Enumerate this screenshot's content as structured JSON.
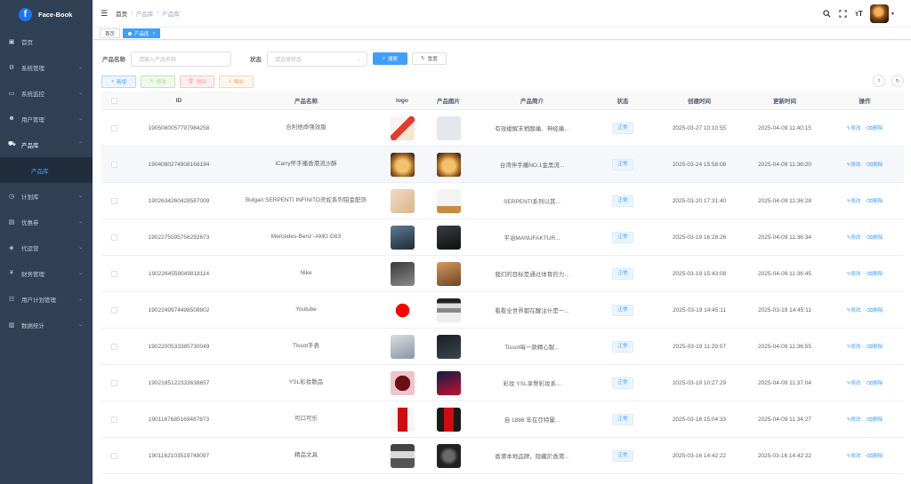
{
  "brand": {
    "logo_letter": "f",
    "name": "Face-Book",
    "color": "#1877f2"
  },
  "sidebar": {
    "items": [
      {
        "icon": "dashboard-icon",
        "glyph": "▣",
        "label": "首页",
        "arrow": ""
      },
      {
        "icon": "gear-icon",
        "glyph": "⚙",
        "label": "系统管理",
        "arrow": "⌄"
      },
      {
        "icon": "monitor-icon",
        "glyph": "▭",
        "label": "系统监控",
        "arrow": "⌄"
      },
      {
        "icon": "user-icon",
        "glyph": "☻",
        "label": "用户管理",
        "arrow": "⌄"
      },
      {
        "icon": "cart-icon",
        "glyph": "⛟",
        "label": "产品库",
        "arrow": "⌃"
      },
      {
        "icon": "calendar-icon",
        "glyph": "◷",
        "label": "计划库",
        "arrow": "⌄"
      },
      {
        "icon": "coupon-icon",
        "glyph": "▤",
        "label": "优惠券",
        "arrow": "⌄"
      },
      {
        "icon": "tag-icon",
        "glyph": "◈",
        "label": "代运营",
        "arrow": "⌄"
      },
      {
        "icon": "yen-icon",
        "glyph": "¥",
        "label": "财务管理",
        "arrow": "⌄"
      },
      {
        "icon": "user-plan-icon",
        "glyph": "☷",
        "label": "用户计划管理",
        "arrow": "⌄"
      },
      {
        "icon": "stats-icon",
        "glyph": "▥",
        "label": "数据统计",
        "arrow": "⌄"
      }
    ],
    "submenu_label": "产品库"
  },
  "header": {
    "breadcrumb": [
      "首页",
      "产品库",
      "产品库"
    ]
  },
  "tags": {
    "home": "首页",
    "active": "产品库"
  },
  "search": {
    "name_label": "产品名称",
    "name_placeholder": "请输入产品名称",
    "status_label": "状态",
    "status_placeholder": "请选择状态",
    "search_btn": "搜索",
    "reset_btn": "重置"
  },
  "toolbar": {
    "add": "新增",
    "edit": "修改",
    "delete": "删除",
    "export": "导出"
  },
  "table": {
    "columns": [
      "ID",
      "产品名称",
      "logo",
      "产品图片",
      "产品简介",
      "状态",
      "创建时间",
      "更新时间",
      "操作"
    ],
    "edit_label": "修改",
    "delete_label": "删除",
    "rows": [
      {
        "id": "1905080057797984258",
        "name": "合利他命强效版",
        "logo": "linear-gradient(135deg,#f7f3ee 0 40%,#e33b2e 40% 60%,#f4e7d4 60%)",
        "pic": "#e4e7ed",
        "intro": "有效缓解末梢酸痛、神经痛...",
        "status": "正常",
        "created": "2025-03-27 10:10:55",
        "updated": "2025-04-09 11:40:15"
      },
      {
        "id": "1904080274908168194",
        "name": "iCarry怀手播香港流沙酥",
        "logo": "radial-gradient(circle at 50% 55%,#f2c26b 0 35%,#a86a22 60%,#3b2410 90%)",
        "pic": "radial-gradient(circle at 50% 55%,#f2c26b 0 35%,#a86a22 60%,#3b2410 90%)",
        "intro": "台湾伴手播NO.1金黑流...",
        "status": "正常",
        "created": "2025-03-24 15:58:08",
        "updated": "2025-04-09 11:36:20"
      },
      {
        "id": "1902634260428587009",
        "name": "Bulgari SERPENTI INFINITO灵蛇系列铂金配饰",
        "logo": "linear-gradient(135deg,#f1dcc3,#d9b48c)",
        "pic": "linear-gradient(180deg,#f3f3f3 0 70%,#c98b3e 70%)",
        "intro": "SERPENTI系列以其...",
        "status": "正常",
        "created": "2025-03-20 17:31:40",
        "updated": "2025-04-09 11:36:28"
      },
      {
        "id": "1902275595756292673",
        "name": "Mercedes-Benz -AMG G63",
        "logo": "linear-gradient(160deg,#5f7a93,#1e2b38)",
        "pic": "linear-gradient(160deg,#3a3d42,#0d0f12)",
        "intro": "平治MANUFAKTUR...",
        "status": "正常",
        "created": "2025-03-19 16:28:26",
        "updated": "2025-04-09 11:36:34"
      },
      {
        "id": "1902264559049818114",
        "name": "Nike",
        "logo": "linear-gradient(160deg,#3a3a3a,#8b8b8b)",
        "pic": "linear-gradient(160deg,#d79a5e,#6b4424)",
        "intro": "我们的目标是通过体育的力...",
        "status": "正常",
        "created": "2025-03-19 15:43:08",
        "updated": "2025-04-09 11:36:45"
      },
      {
        "id": "1902249974498508802",
        "name": "Youtube",
        "logo": "radial-gradient(circle,#ff0000 0 40%,#ffffff 41%)",
        "pic": "linear-gradient(180deg,#222 0 20%,#ddd 20% 40%,#888 40% 60%,#eee 60%)",
        "intro": "看看全世界都在醒注什是一...",
        "status": "正常",
        "created": "2025-03-19 14:45:11",
        "updated": "2025-03-19 14:45:11"
      },
      {
        "id": "1902200533385730049",
        "name": "Tissot手表",
        "logo": "linear-gradient(160deg,#d8dde3,#8a96a4)",
        "pic": "linear-gradient(160deg,#1b1f24,#3a4650)",
        "intro": "Tissot每一款精心製...",
        "status": "正常",
        "created": "2025-03-19 11:29:07",
        "updated": "2025-04-09 11:36:55"
      },
      {
        "id": "1902185122333638657",
        "name": "YSL彩妆散品",
        "logo": "radial-gradient(circle,#6b0f15 0 45%,#f1c3c8 46%)",
        "pic": "linear-gradient(160deg,#0b1d4a,#c8102e)",
        "intro": "彩妆 YSL享譽彩妆系...",
        "status": "正常",
        "created": "2025-03-19 10:27:29",
        "updated": "2025-04-09 11:37:04"
      },
      {
        "id": "1901167685169487873",
        "name": "可口可乐",
        "logo": "linear-gradient(90deg,#f6f6f6 0 30%,#d20a11 30% 70%,#f6f6f6 70%)",
        "pic": "linear-gradient(90deg,#1a1a1a 0 30%,#d20a11 30% 70%,#1a1a1a 70%)",
        "intro": "自 1886 年在亞特蘭...",
        "status": "正常",
        "created": "2025-03-16 15:04:33",
        "updated": "2025-04-09 11:34:27"
      },
      {
        "id": "1901162103519748097",
        "name": "精品文具",
        "logo": "linear-gradient(180deg,#444 0 30%,#d9d9d9 30% 60%,#555 60%)",
        "pic": "radial-gradient(circle,#6a6a6a 0 30%,#222 55%)",
        "intro": "香港本地品牌，隐藏於香港...",
        "status": "正常",
        "created": "2025-03-16 14:42:22",
        "updated": "2025-03-16 14:42:22"
      }
    ]
  }
}
